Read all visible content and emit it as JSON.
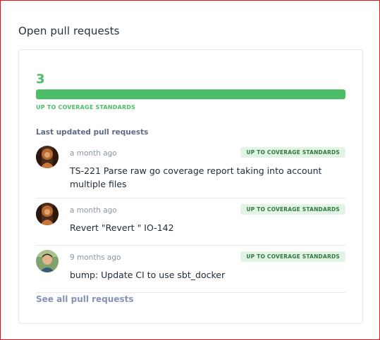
{
  "section": {
    "title": "Open pull requests"
  },
  "summary": {
    "count": "3",
    "progress_fraction": 1.0,
    "label": "UP TO COVERAGE STANDARDS"
  },
  "list": {
    "heading": "Last updated pull requests",
    "items": [
      {
        "time": "a month ago",
        "badge": "UP TO COVERAGE STANDARDS",
        "title": "TS-221 Parse raw go coverage report taking into account multiple files",
        "avatar": "user-avatar-1"
      },
      {
        "time": "a month ago",
        "badge": "UP TO COVERAGE STANDARDS",
        "title": "Revert \"Revert \" IO-142",
        "avatar": "user-avatar-1"
      },
      {
        "time": "9 months ago",
        "badge": "UP TO COVERAGE STANDARDS",
        "title": "bump: Update CI to use sbt_docker",
        "avatar": "user-avatar-2"
      }
    ]
  },
  "footer": {
    "see_all_label": "See all pull requests"
  },
  "colors": {
    "accent_green": "#4cbe68",
    "badge_bg": "#e3f4e6",
    "badge_text": "#2f7a3f",
    "link": "#8592b8",
    "frame_border": "#e01515"
  }
}
